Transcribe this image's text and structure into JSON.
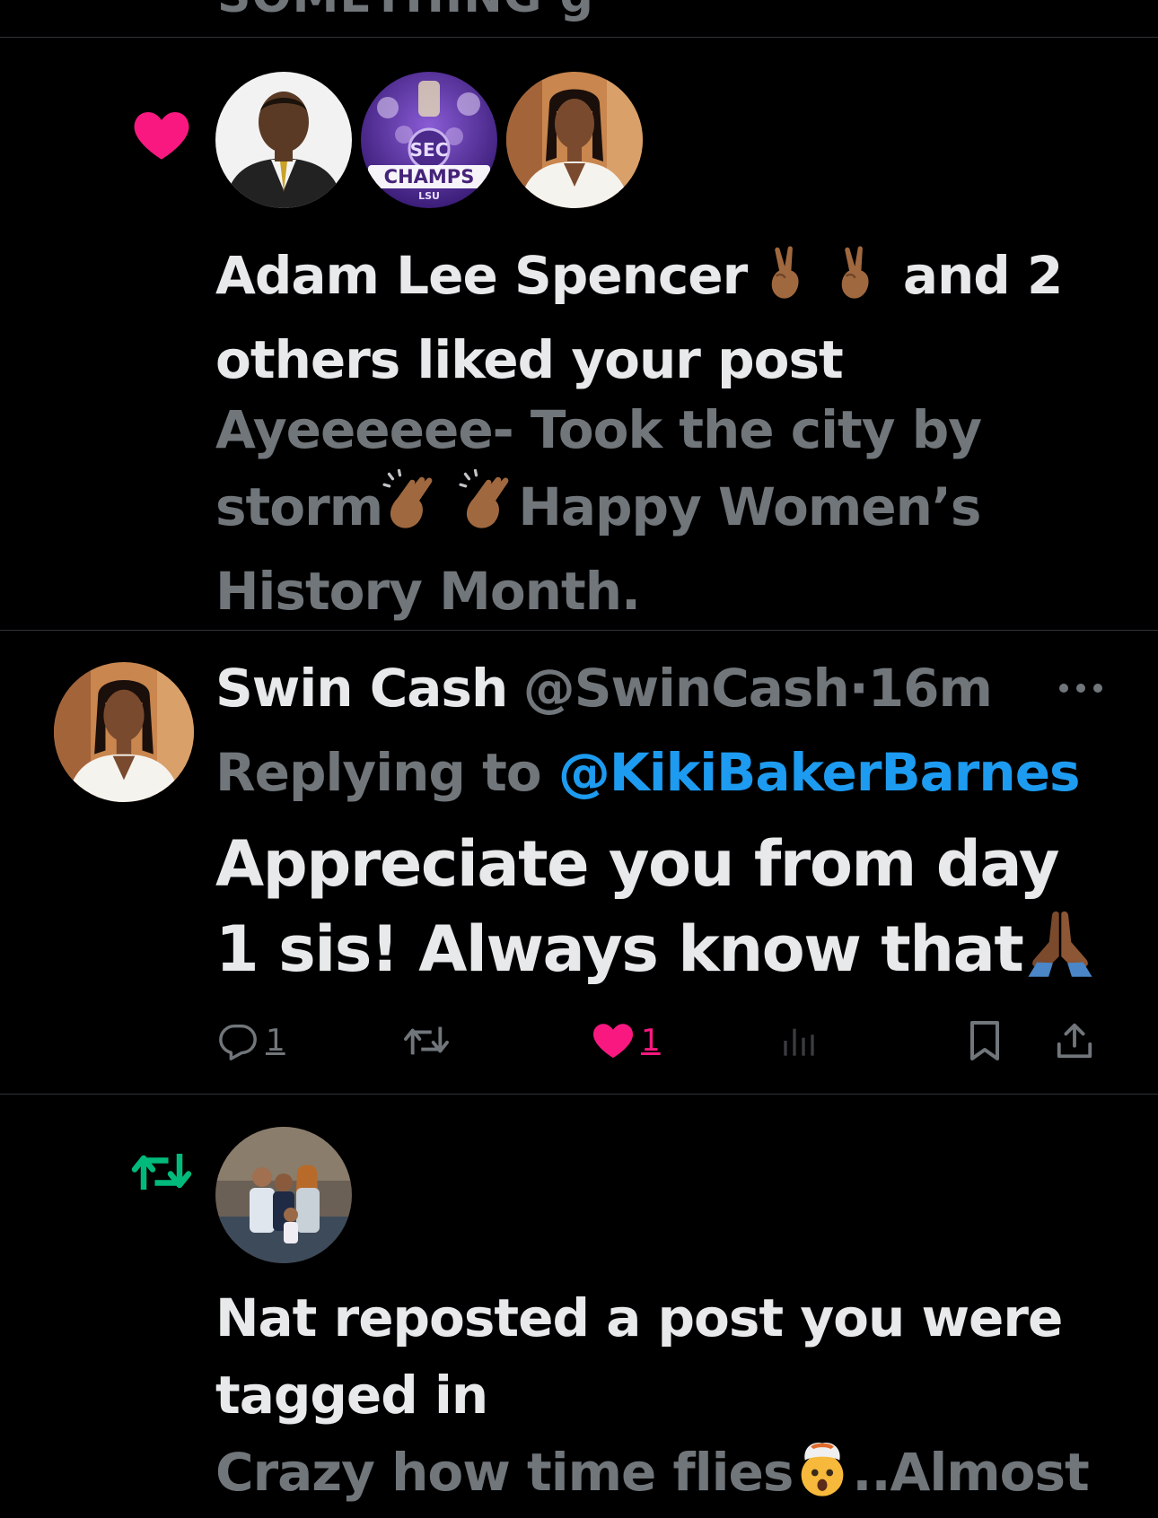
{
  "top": {
    "truncated_text": "SOMETHING g"
  },
  "like_notification": {
    "icon": "heart-icon",
    "icon_color": "#f91880",
    "avatars": [
      "avatar-man-in-suit",
      "avatar-sec-champs-lsu",
      "avatar-swin-cash"
    ],
    "avatar_2_badge": "SEC",
    "avatar_2_text": "CHAMPS",
    "avatar_2_subtext": "LSU",
    "actor": "Adam Lee Spencer",
    "actor_emoji": "✌🏾✌🏾",
    "rest": "and 2 others liked your post",
    "snippet_part1": "Ayeeeeee- Took the city by storm",
    "snippet_emoji": "👏🏾👏🏾",
    "snippet_part2": "Happy Women’s History Month."
  },
  "tweet": {
    "name": "Swin Cash",
    "handle": "@SwinCash",
    "separator": "·",
    "time": "16m",
    "replying_prefix": "Replying to",
    "replying_to": "@KikiBakerBarnes",
    "body_text": "Appreciate you from day 1 sis! Always know that",
    "body_emoji": "🙏🏾",
    "actions": {
      "reply_count": "1",
      "retweet_count": "",
      "like_count": "1",
      "views_count": ""
    },
    "accent_blue": "#1d9bf0",
    "like_color": "#f91880"
  },
  "repost_notification": {
    "icon": "repost-icon",
    "icon_color": "#00ba7c",
    "avatar": "avatar-nat-family",
    "title": "Nat reposted a post you were tagged in",
    "snippet_part1": "Crazy how time flies",
    "snippet_emoji": "🤯",
    "snippet_part2": "..Almost"
  }
}
